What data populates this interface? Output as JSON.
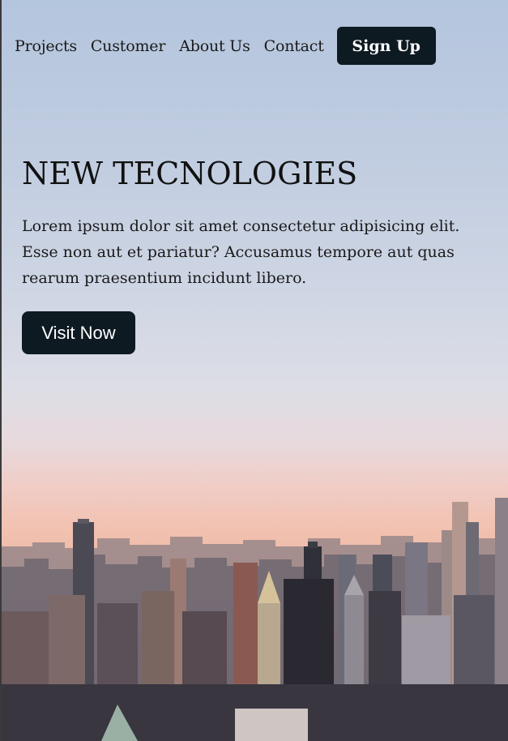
{
  "nav": {
    "links": [
      "Projects",
      "Customer",
      "About Us",
      "Contact"
    ],
    "signup_label": "Sign Up"
  },
  "hero": {
    "title": "NEW TECNOLOGIES",
    "description": "Lorem ipsum dolor sit amet consectetur adipisicing elit. Esse non aut et pariatur? Accusamus tempore aut quas rearum praesentium incidunt libero.",
    "cta_label": "Visit Now",
    "background": "city-skyline-sunset-photo"
  },
  "colors": {
    "button_bg": "#0e1a22",
    "button_text": "#ffffff",
    "text": "#111111"
  }
}
